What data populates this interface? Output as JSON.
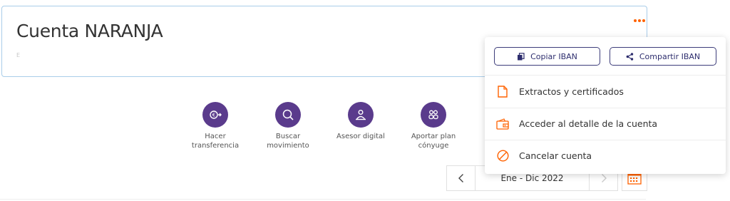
{
  "account": {
    "title": "Cuenta NARANJA",
    "number_hint": "E"
  },
  "quick_actions": [
    {
      "label_line1": "Hacer",
      "label_line2": "transferencia",
      "icon": "euro-transfer-icon"
    },
    {
      "label_line1": "Buscar",
      "label_line2": "movimiento",
      "icon": "search-icon"
    },
    {
      "label_line1": "Asesor digital",
      "label_line2": "",
      "icon": "advisor-icon"
    },
    {
      "label_line1": "Aportar plan",
      "label_line2": "cónyuge",
      "icon": "couple-icon"
    }
  ],
  "period": {
    "label": "Ene - Dic 2022"
  },
  "menu": {
    "copy_iban": "Copiar IBAN",
    "share_iban": "Compartir IBAN",
    "items": [
      {
        "label": "Extractos y certificados",
        "icon": "document-icon"
      },
      {
        "label": "Acceder al detalle de la cuenta",
        "icon": "wallet-icon"
      },
      {
        "label": "Cancelar cuenta",
        "icon": "cancel-icon"
      }
    ]
  },
  "colors": {
    "brand_orange": "#ff6200",
    "action_purple": "#5a3b8c",
    "button_navy": "#2e2e6e",
    "card_border": "#a9cde9"
  }
}
